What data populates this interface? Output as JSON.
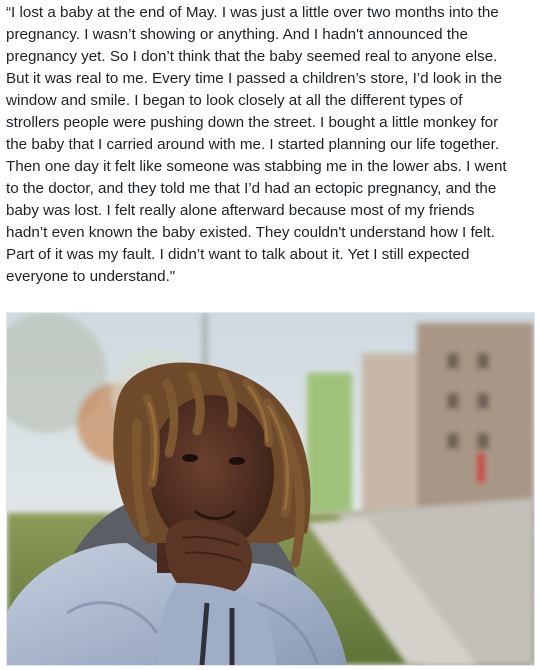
{
  "post": {
    "caption": "“I lost a baby at the end of May. I was just a little over two months into the\npregnancy. I wasn’t showing or anything. And I hadn't announced the\npregnancy yet. So I don’t think that the baby seemed real to anyone else.\nBut it was real to me. Every time I passed a children’s store, I’d look in the\nwindow and smile. I began to look closely at all the different types of\nstrollers people were pushing down the street. I bought a little monkey for\nthe baby that I carried around with me. I started planning our life together.\nThen one day it felt like someone was stabbing me in the lower abs. I went\nto the doctor, and they told me that I’d had an ectopic pregnancy, and the\nbaby was lost. I felt really alone afterward because most of my friends\nhadn’t even known the baby existed. They couldn't understand how I felt.\nPart of it was my fault. I didn’t want to talk about it. Yet I still expected\neveryone to understand.\"",
    "photo": {
      "subject": "portrait-photo",
      "colors": {
        "sky": "#dfe8ee",
        "grass": "#7b8f4a",
        "jacket": "#a8b6cc",
        "skin": "#5a3526",
        "hair": "#6e4a2a",
        "buildings": "#b9a89a",
        "sidewalk": "#bfbcb6"
      }
    }
  }
}
